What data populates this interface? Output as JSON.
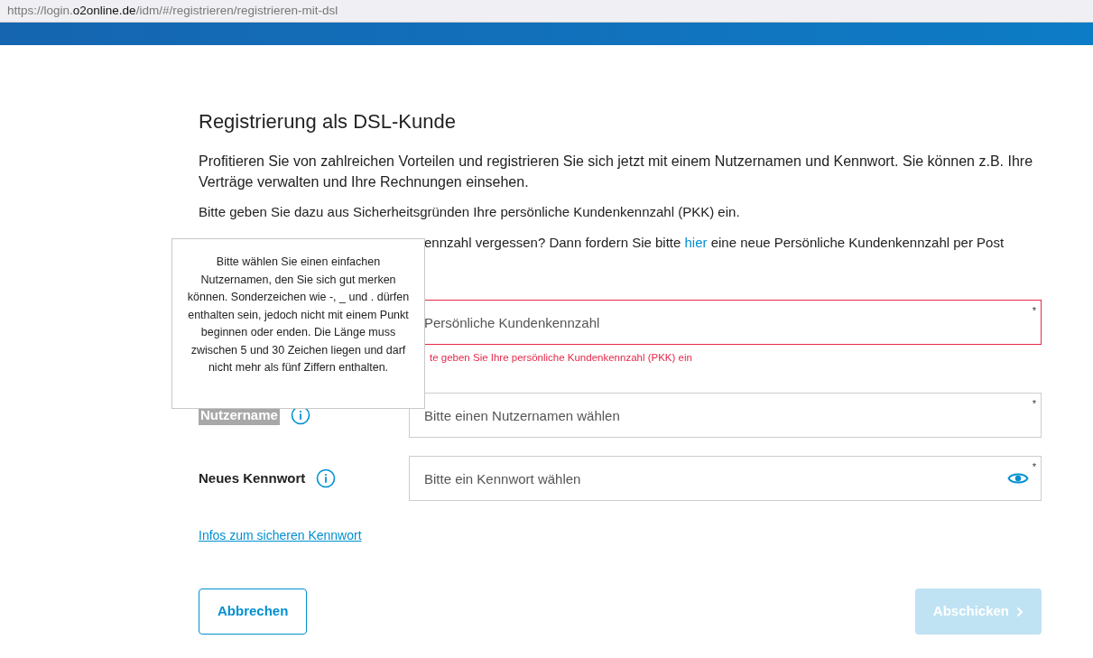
{
  "address_bar": {
    "prefix": "https://login.",
    "domain": "o2online.de",
    "path": "/idm/#/registrieren/registrieren-mit-dsl"
  },
  "heading": "Registrierung als DSL-Kunde",
  "paragraphs": [
    "Profitieren Sie von zahlreichen Vorteilen und registrieren Sie sich jetzt mit einem Nutzernamen und Kennwort. Sie können z.B. Ihre Verträge verwalten und Ihre Rechnungen einsehen.",
    "Bitte geben Sie dazu aus Sicherheitsgründen Ihre persönliche Kundenkennzahl (PKK) ein."
  ],
  "partial_paragraph": {
    "before": "ennzahl vergessen? Dann fordern Sie bitte ",
    "link": "hier",
    "after": " eine neue Persönliche Kundenkennzahl per Post"
  },
  "fields": [
    {
      "kind": "text",
      "placeholder": "Persönliche Kundenkennzahl",
      "required_mark": "*",
      "error": true,
      "error_text": "te geben Sie Ihre persönliche Kundenkennzahl (PKK) ein"
    },
    {
      "kind": "text",
      "label": "Nutzername",
      "label_selected": true,
      "placeholder": "Bitte einen Nutzernamen wählen",
      "required_mark": "*",
      "error": false
    },
    {
      "kind": "password",
      "label": "Neues Kennwort",
      "label_selected": false,
      "placeholder": "Bitte ein Kennwort wählen",
      "required_mark": "*",
      "error": false
    }
  ],
  "tooltip": "Bitte wählen Sie einen einfachen Nutzernamen, den Sie sich gut merken können. Sonderzeichen wie -, _ und . dürfen enthalten sein, jedoch nicht mit einem Punkt beginnen oder enden. Die Länge muss zwischen 5 und 30 Zeichen liegen und darf nicht mehr als fünf Ziffern enthalten.",
  "info_link": "Infos zum sicheren Kennwort",
  "buttons": [
    {
      "kind": "secondary",
      "label": "Abbrechen"
    },
    {
      "kind": "primary",
      "label": "Abschicken",
      "disabled": true
    }
  ]
}
